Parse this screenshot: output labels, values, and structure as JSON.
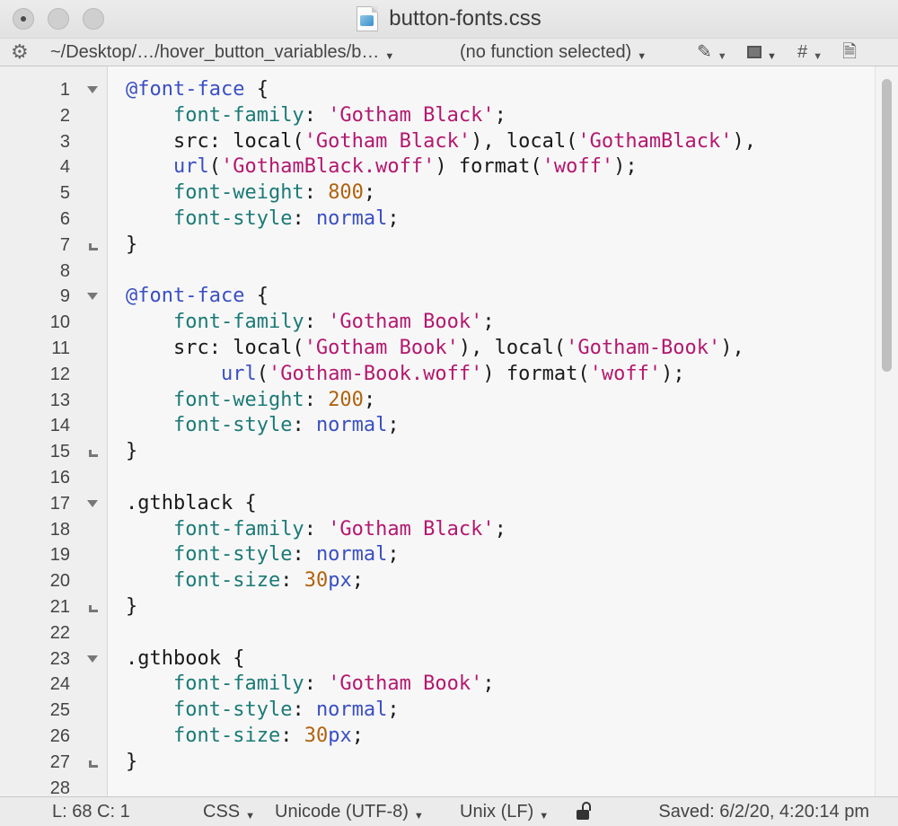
{
  "window": {
    "title": "button-fonts.css"
  },
  "navbar": {
    "gear_icon": "gear-icon",
    "path": "~/Desktop/…/hover_button_variables/b…",
    "function_popup": "(no function selected)",
    "marker_icon": "pen-icon",
    "markers_symbol": "⬤",
    "hash_label": "#",
    "document_icon": "file-icon"
  },
  "editor": {
    "lines": [
      {
        "n": "1",
        "fold": "start",
        "tokens": [
          {
            "c": "t-at",
            "t": "@font-face"
          },
          {
            "c": "t-plain",
            "t": " {"
          }
        ]
      },
      {
        "n": "2",
        "fold": "",
        "tokens": [
          {
            "c": "t-plain",
            "t": "    "
          },
          {
            "c": "t-prop",
            "t": "font-family"
          },
          {
            "c": "t-plain",
            "t": ": "
          },
          {
            "c": "t-str",
            "t": "'Gotham Black'"
          },
          {
            "c": "t-plain",
            "t": ";"
          }
        ]
      },
      {
        "n": "3",
        "fold": "",
        "tokens": [
          {
            "c": "t-plain",
            "t": "    src: local("
          },
          {
            "c": "t-str",
            "t": "'Gotham Black'"
          },
          {
            "c": "t-plain",
            "t": "), local("
          },
          {
            "c": "t-str",
            "t": "'GothamBlack'"
          },
          {
            "c": "t-plain",
            "t": "),"
          }
        ]
      },
      {
        "n": "4",
        "fold": "",
        "tokens": [
          {
            "c": "t-plain",
            "t": "    "
          },
          {
            "c": "t-kw",
            "t": "url"
          },
          {
            "c": "t-plain",
            "t": "("
          },
          {
            "c": "t-str",
            "t": "'GothamBlack.woff'"
          },
          {
            "c": "t-plain",
            "t": ") format("
          },
          {
            "c": "t-str",
            "t": "'woff'"
          },
          {
            "c": "t-plain",
            "t": ");"
          }
        ]
      },
      {
        "n": "5",
        "fold": "",
        "tokens": [
          {
            "c": "t-plain",
            "t": "    "
          },
          {
            "c": "t-prop",
            "t": "font-weight"
          },
          {
            "c": "t-plain",
            "t": ": "
          },
          {
            "c": "t-num",
            "t": "800"
          },
          {
            "c": "t-plain",
            "t": ";"
          }
        ]
      },
      {
        "n": "6",
        "fold": "",
        "tokens": [
          {
            "c": "t-plain",
            "t": "    "
          },
          {
            "c": "t-prop",
            "t": "font-style"
          },
          {
            "c": "t-plain",
            "t": ": "
          },
          {
            "c": "t-kw",
            "t": "normal"
          },
          {
            "c": "t-plain",
            "t": ";"
          }
        ]
      },
      {
        "n": "7",
        "fold": "end",
        "tokens": [
          {
            "c": "t-plain",
            "t": "}"
          }
        ]
      },
      {
        "n": "8",
        "fold": "",
        "tokens": []
      },
      {
        "n": "9",
        "fold": "start",
        "tokens": [
          {
            "c": "t-at",
            "t": "@font-face"
          },
          {
            "c": "t-plain",
            "t": " {"
          }
        ]
      },
      {
        "n": "10",
        "fold": "",
        "tokens": [
          {
            "c": "t-plain",
            "t": "    "
          },
          {
            "c": "t-prop",
            "t": "font-family"
          },
          {
            "c": "t-plain",
            "t": ": "
          },
          {
            "c": "t-str",
            "t": "'Gotham Book'"
          },
          {
            "c": "t-plain",
            "t": ";"
          }
        ]
      },
      {
        "n": "11",
        "fold": "",
        "tokens": [
          {
            "c": "t-plain",
            "t": "    src: local("
          },
          {
            "c": "t-str",
            "t": "'Gotham Book'"
          },
          {
            "c": "t-plain",
            "t": "), local("
          },
          {
            "c": "t-str",
            "t": "'Gotham-Book'"
          },
          {
            "c": "t-plain",
            "t": "),"
          }
        ]
      },
      {
        "n": "12",
        "fold": "",
        "tokens": [
          {
            "c": "t-plain",
            "t": "        "
          },
          {
            "c": "t-kw",
            "t": "url"
          },
          {
            "c": "t-plain",
            "t": "("
          },
          {
            "c": "t-str",
            "t": "'Gotham-Book.woff'"
          },
          {
            "c": "t-plain",
            "t": ") format("
          },
          {
            "c": "t-str",
            "t": "'woff'"
          },
          {
            "c": "t-plain",
            "t": ");"
          }
        ]
      },
      {
        "n": "13",
        "fold": "",
        "tokens": [
          {
            "c": "t-plain",
            "t": "    "
          },
          {
            "c": "t-prop",
            "t": "font-weight"
          },
          {
            "c": "t-plain",
            "t": ": "
          },
          {
            "c": "t-num",
            "t": "200"
          },
          {
            "c": "t-plain",
            "t": ";"
          }
        ]
      },
      {
        "n": "14",
        "fold": "",
        "tokens": [
          {
            "c": "t-plain",
            "t": "    "
          },
          {
            "c": "t-prop",
            "t": "font-style"
          },
          {
            "c": "t-plain",
            "t": ": "
          },
          {
            "c": "t-kw",
            "t": "normal"
          },
          {
            "c": "t-plain",
            "t": ";"
          }
        ]
      },
      {
        "n": "15",
        "fold": "end",
        "tokens": [
          {
            "c": "t-plain",
            "t": "}"
          }
        ]
      },
      {
        "n": "16",
        "fold": "",
        "tokens": []
      },
      {
        "n": "17",
        "fold": "start",
        "tokens": [
          {
            "c": "t-sel",
            "t": ".gthblack"
          },
          {
            "c": "t-plain",
            "t": " {"
          }
        ]
      },
      {
        "n": "18",
        "fold": "",
        "tokens": [
          {
            "c": "t-plain",
            "t": "    "
          },
          {
            "c": "t-prop",
            "t": "font-family"
          },
          {
            "c": "t-plain",
            "t": ": "
          },
          {
            "c": "t-str",
            "t": "'Gotham Black'"
          },
          {
            "c": "t-plain",
            "t": ";"
          }
        ]
      },
      {
        "n": "19",
        "fold": "",
        "tokens": [
          {
            "c": "t-plain",
            "t": "    "
          },
          {
            "c": "t-prop",
            "t": "font-style"
          },
          {
            "c": "t-plain",
            "t": ": "
          },
          {
            "c": "t-kw",
            "t": "normal"
          },
          {
            "c": "t-plain",
            "t": ";"
          }
        ]
      },
      {
        "n": "20",
        "fold": "",
        "tokens": [
          {
            "c": "t-plain",
            "t": "    "
          },
          {
            "c": "t-prop",
            "t": "font-size"
          },
          {
            "c": "t-plain",
            "t": ": "
          },
          {
            "c": "t-num",
            "t": "30"
          },
          {
            "c": "t-kw",
            "t": "px"
          },
          {
            "c": "t-plain",
            "t": ";"
          }
        ]
      },
      {
        "n": "21",
        "fold": "end",
        "tokens": [
          {
            "c": "t-plain",
            "t": "}"
          }
        ]
      },
      {
        "n": "22",
        "fold": "",
        "tokens": []
      },
      {
        "n": "23",
        "fold": "start",
        "tokens": [
          {
            "c": "t-sel",
            "t": ".gthbook"
          },
          {
            "c": "t-plain",
            "t": " {"
          }
        ]
      },
      {
        "n": "24",
        "fold": "",
        "tokens": [
          {
            "c": "t-plain",
            "t": "    "
          },
          {
            "c": "t-prop",
            "t": "font-family"
          },
          {
            "c": "t-plain",
            "t": ": "
          },
          {
            "c": "t-str",
            "t": "'Gotham Book'"
          },
          {
            "c": "t-plain",
            "t": ";"
          }
        ]
      },
      {
        "n": "25",
        "fold": "",
        "tokens": [
          {
            "c": "t-plain",
            "t": "    "
          },
          {
            "c": "t-prop",
            "t": "font-style"
          },
          {
            "c": "t-plain",
            "t": ": "
          },
          {
            "c": "t-kw",
            "t": "normal"
          },
          {
            "c": "t-plain",
            "t": ";"
          }
        ]
      },
      {
        "n": "26",
        "fold": "",
        "tokens": [
          {
            "c": "t-plain",
            "t": "    "
          },
          {
            "c": "t-prop",
            "t": "font-size"
          },
          {
            "c": "t-plain",
            "t": ": "
          },
          {
            "c": "t-num",
            "t": "30"
          },
          {
            "c": "t-kw",
            "t": "px"
          },
          {
            "c": "t-plain",
            "t": ";"
          }
        ]
      },
      {
        "n": "27",
        "fold": "end",
        "tokens": [
          {
            "c": "t-plain",
            "t": "}"
          }
        ]
      },
      {
        "n": "28",
        "fold": "",
        "tokens": []
      }
    ]
  },
  "statusbar": {
    "position": "L: 68 C: 1",
    "language": "CSS",
    "encoding": "Unicode (UTF-8)",
    "line_endings": "Unix (LF)",
    "lock_icon": "lock-icon",
    "saved": "Saved: 6/2/20, 4:20:14 pm"
  },
  "colors": {
    "at_rule": "#3a4fc2",
    "property": "#1b7a76",
    "string": "#b3186e",
    "number": "#b0630f",
    "keyword": "#3a4fc2"
  }
}
